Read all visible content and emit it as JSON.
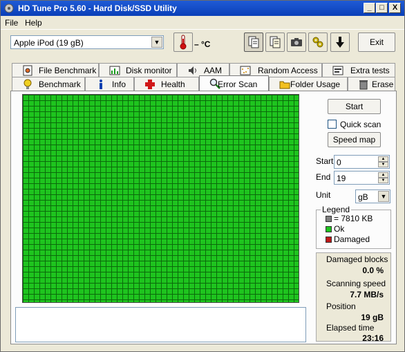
{
  "window": {
    "title": "HD Tune Pro 5.60 - Hard Disk/SSD Utility",
    "controls": {
      "minimize": "_",
      "maximize": "□",
      "close": "X"
    }
  },
  "menu": {
    "file": "File",
    "help": "Help"
  },
  "toolbar": {
    "drive": "Apple   iPod (19 gB)",
    "temperature": "– °C",
    "exit_label": "Exit",
    "icons": [
      "thermometer-icon",
      "copy-info-icon",
      "copy-all-icon",
      "screenshot-camera-icon",
      "health-options-icon",
      "save-down-icon"
    ]
  },
  "tabs": {
    "row1": [
      {
        "label": "File Benchmark",
        "icon": "file-benchmark-icon"
      },
      {
        "label": "Disk monitor",
        "icon": "disk-monitor-icon"
      },
      {
        "label": "AAM",
        "icon": "speaker-icon"
      },
      {
        "label": "Random Access",
        "icon": "random-access-icon"
      },
      {
        "label": "Extra tests",
        "icon": "extra-tests-icon"
      }
    ],
    "row2": [
      {
        "label": "Benchmark",
        "icon": "lightbulb-icon"
      },
      {
        "label": "Info",
        "icon": "info-icon"
      },
      {
        "label": "Health",
        "icon": "health-cross-icon"
      },
      {
        "label": "Error Scan",
        "icon": "magnifier-icon",
        "active": true
      },
      {
        "label": "Folder Usage",
        "icon": "folder-icon"
      },
      {
        "label": "Erase",
        "icon": "trash-icon"
      }
    ]
  },
  "scan": {
    "start_button": "Start",
    "quick_scan_label": "Quick scan",
    "quick_scan_checked": false,
    "speed_map_button": "Speed map",
    "start_label": "Start",
    "start_value": "0",
    "end_label": "End",
    "end_value": "19",
    "unit_label": "Unit",
    "unit_value": "gB"
  },
  "legend": {
    "title": "Legend",
    "block_size": "= 7810 KB",
    "ok": "Ok",
    "damaged": "Damaged",
    "colors": {
      "block": "#808080",
      "ok": "#1ec41e",
      "damaged": "#c01818"
    }
  },
  "stats": {
    "damaged_blocks_label": "Damaged blocks",
    "damaged_blocks_value": "0.0 %",
    "scanning_speed_label": "Scanning speed",
    "scanning_speed_value": "7.7 MB/s",
    "position_label": "Position",
    "position_value": "19 gB",
    "elapsed_label": "Elapsed time",
    "elapsed_value": "23:16"
  },
  "scan_grid": {
    "state": "all blocks ok",
    "color": "#1ec41e"
  }
}
